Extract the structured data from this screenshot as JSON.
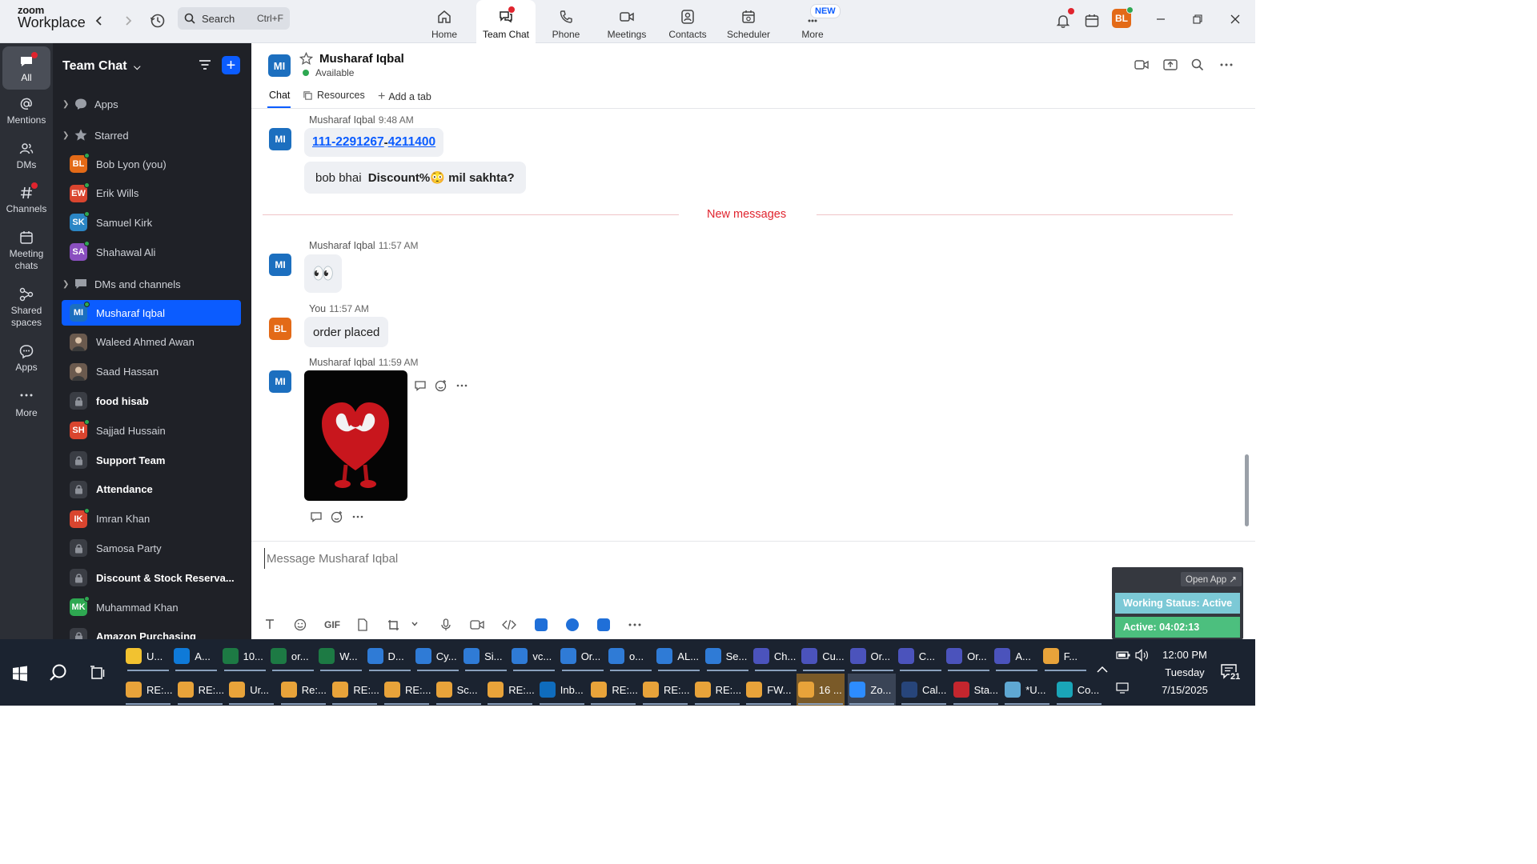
{
  "app": {
    "logo_line1": "zoom",
    "logo_line2": "Workplace"
  },
  "search": {
    "label": "Search",
    "shortcut": "Ctrl+F"
  },
  "nav_tabs": [
    {
      "label": "Home",
      "icon": "home-icon"
    },
    {
      "label": "Team Chat",
      "icon": "team-chat-icon"
    },
    {
      "label": "Phone",
      "icon": "phone-icon"
    },
    {
      "label": "Meetings",
      "icon": "video-icon"
    },
    {
      "label": "Contacts",
      "icon": "contacts-icon"
    },
    {
      "label": "Scheduler",
      "icon": "calendar-icon"
    },
    {
      "label": "More",
      "icon": "more-icon",
      "badge": "NEW"
    }
  ],
  "user": {
    "initials": "BL",
    "color": "#e36a17"
  },
  "rail": [
    {
      "label": "All"
    },
    {
      "label": "Mentions"
    },
    {
      "label": "DMs"
    },
    {
      "label": "Channels"
    },
    {
      "label": "Meeting chats"
    },
    {
      "label": "Shared spaces"
    },
    {
      "label": "Apps"
    },
    {
      "label": "More"
    }
  ],
  "sidebar": {
    "title": "Team Chat",
    "sections": {
      "apps": "Apps",
      "starred": "Starred",
      "dms": "DMs and channels"
    },
    "starred": [
      {
        "initials": "BL",
        "name": "Bob Lyon (you)",
        "color": "#e36a17"
      },
      {
        "initials": "EW",
        "name": "Erik Wills",
        "color": "#d9452f"
      },
      {
        "initials": "SK",
        "name": "Samuel Kirk",
        "color": "#2b86c5"
      },
      {
        "initials": "SA",
        "name": "Shahawal Ali",
        "color": "#8a4fbf"
      }
    ],
    "items": [
      {
        "initials": "MI",
        "name": "Musharaf Iqbal",
        "type": "avatar",
        "color": "#1c6fbf",
        "selected": true
      },
      {
        "initials": "",
        "name": "Waleed Ahmed Awan",
        "type": "photo"
      },
      {
        "initials": "",
        "name": "Saad Hassan",
        "type": "photo"
      },
      {
        "initials": "",
        "name": "food hisab",
        "type": "lock",
        "bold": true
      },
      {
        "initials": "SH",
        "name": "Sajjad Hussain",
        "type": "avatar",
        "color": "#d9452f"
      },
      {
        "initials": "",
        "name": "Support Team",
        "type": "lock",
        "bold": true
      },
      {
        "initials": "",
        "name": "Attendance",
        "type": "lock",
        "bold": true
      },
      {
        "initials": "IK",
        "name": "Imran Khan",
        "type": "avatar",
        "color": "#d9452f"
      },
      {
        "initials": "",
        "name": "Samosa Party",
        "type": "lock"
      },
      {
        "initials": "",
        "name": "Discount & Stock Reserva...",
        "type": "lock",
        "bold": true
      },
      {
        "initials": "MK",
        "name": "Muhammad Khan",
        "type": "avatar",
        "color": "#2ea851"
      },
      {
        "initials": "",
        "name": "Amazon Purchasing",
        "type": "lock",
        "bold": true
      }
    ]
  },
  "chat": {
    "initials": "MI",
    "name": "Musharaf Iqbal",
    "status": "Available",
    "tabs": {
      "chat": "Chat",
      "resources": "Resources",
      "add": "Add a tab"
    }
  },
  "messages": {
    "m1": {
      "author": "Musharaf Iqbal",
      "time": "9:48 AM",
      "phone_a": "111-2291267",
      "phone_sep": "-",
      "phone_b": "4211400"
    },
    "m2": {
      "plain": "bob bhai ",
      "bold": "Discount%",
      "emoji": "😳",
      "bold2": " mil sakhta?"
    },
    "divider": "New messages",
    "m3": {
      "author": "Musharaf Iqbal",
      "time": "11:57 AM",
      "emoji": "👀"
    },
    "m4": {
      "author": "You",
      "time": "11:57 AM",
      "text": "order placed",
      "initials": "BL"
    },
    "m5": {
      "author": "Musharaf Iqbal",
      "time": "11:59 AM"
    }
  },
  "composer": {
    "placeholder": "Message Musharaf Iqbal",
    "gif": "GIF"
  },
  "widget": {
    "open": "Open App ↗",
    "working": "Working Status: Active",
    "active": "Active: 04:02:13"
  },
  "taskbar": {
    "row1": [
      "U...",
      "A...",
      "10...",
      "or...",
      "W...",
      "D...",
      "Cy...",
      "Si...",
      "vc...",
      "Or...",
      "o...",
      "AL...",
      "Se...",
      "Ch...",
      "Cu...",
      "Or...",
      "C...",
      "Or...",
      "A...",
      "F..."
    ],
    "row2": [
      "RE:...",
      "RE:...",
      "Ur...",
      "Re:...",
      "RE:...",
      "RE:...",
      "Sc...",
      "RE:...",
      "Inb...",
      "RE:...",
      "RE:...",
      "RE:...",
      "FW...",
      "16 ...",
      "Zo...",
      "Cal...",
      "Sta...",
      "*U...",
      "Co..."
    ],
    "time": "12:00 PM",
    "day": "Tuesday",
    "date": "7/15/2025",
    "notif": "21"
  },
  "colors": {
    "accent": "#0b5cff",
    "sidebar_bg": "#1f2127",
    "rail_bg": "#2c2f36",
    "new_messages": "#e0242e"
  }
}
